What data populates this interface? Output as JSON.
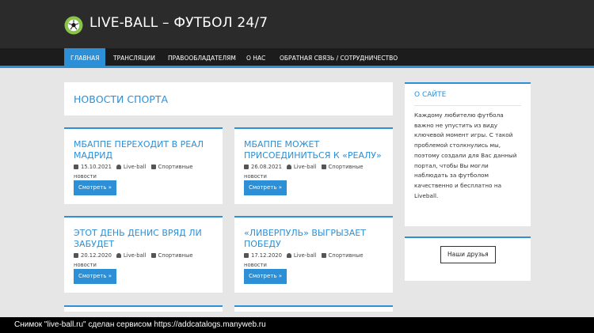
{
  "header": {
    "site_title": "LIVE-BALL – ФУТБОЛ 24/7",
    "logo_icon": "soccer-ball-icon"
  },
  "nav": {
    "items": [
      {
        "label": "ГЛАВНАЯ",
        "active": true
      },
      {
        "label": "ТРАНСЛЯЦИИ"
      },
      {
        "label": "ПРАВООБЛАДАТЕЛЯМ"
      },
      {
        "label": "О НАС"
      },
      {
        "label": "ОБРАТНАЯ СВЯЗЬ / СОТРУДНИЧЕСТВО"
      }
    ]
  },
  "main": {
    "page_title": "НОВОСТИ СПОРТА",
    "posts": [
      {
        "title": "МБАППЕ ПЕРЕХОДИТ В РЕАЛ МАДРИД",
        "date": "15.10.2021",
        "author": "Live-ball",
        "category": "Спортивные новости",
        "button": "Смотреть »"
      },
      {
        "title": "МБАППЕ МОЖЕТ ПРИСОЕДИНИТЬСЯ К «РЕАЛУ»",
        "date": "26.08.2021",
        "author": "Live-ball",
        "category": "Спортивные новости",
        "button": "Смотреть »"
      },
      {
        "title": "ЭТОТ ДЕНЬ ДЕНИС ВРЯД ЛИ ЗАБУДЕТ",
        "date": "20.12.2020",
        "author": "Live-ball",
        "category": "Спортивные новости",
        "button": "Смотреть »"
      },
      {
        "title": "«ЛИВЕРПУЛЬ» ВЫГРЫЗАЕТ ПОБЕДУ",
        "date": "17.12.2020",
        "author": "Live-ball",
        "category": "Спортивные новости",
        "button": "Смотреть »"
      }
    ]
  },
  "sidebar": {
    "about_title": "О САЙТЕ",
    "about_text": "Каждому любителю футбола важно не упустить из виду ключевой момент игры. С такой проблемой столкнулись мы, поэтому создали для Вас данный портал, чтобы Вы могли наблюдать за футболом качественно и бесплатно на Liveball.",
    "friends_button": "Наши друзья"
  },
  "footer": {
    "caption": "Снимок \"live-ball.ru\" сделан сервисом https://addcatalogs.manyweb.ru"
  },
  "colors": {
    "accent": "#2d8fd6",
    "header_bg": "#2b2b2b",
    "nav_bg": "#1c1c1c",
    "page_bg": "#e6e6e6"
  }
}
